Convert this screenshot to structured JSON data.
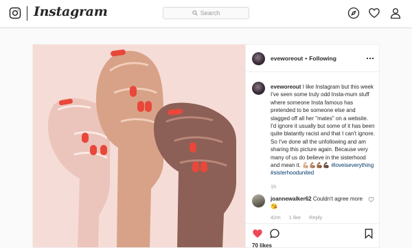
{
  "topnav": {
    "brand": "Instagram",
    "search_placeholder": "Search",
    "icons": [
      "instagram-glyph-icon",
      "search-icon",
      "compass-icon",
      "heart-icon",
      "person-icon"
    ]
  },
  "post": {
    "owner": {
      "username": "eveworeout",
      "follow_state": "Following"
    },
    "caption": {
      "username": "eveworeout",
      "text": "I like Instagram but this week I've seen some truly odd Insta-mum stuff where someone Insta famous has pretended to be someone else and slagged off all her \"mates\" on a website. I'd ignore it usually but some of it has been quite blatantly racist and that I can't ignore. So I've done all the unfollowing and am sharing this picture again. Because very many of us do believe in the sisterhood and mean it.",
      "emoji": "💪🏼💪🏽💪🏾💪🏿",
      "hashtags": [
        "#loveiseverything",
        "#sisterhoodunited"
      ],
      "time": "1h"
    },
    "comment": {
      "username": "joannewalker62",
      "text": "Couldn't agree more",
      "emoji": "😘",
      "time": "42m",
      "likes": "1 like",
      "reply_label": "Reply"
    },
    "likes_text": "70 likes",
    "colors": {
      "background": "#f6dcd7",
      "skin_light": "#ebc4bb",
      "skin_medium": "#d7a287",
      "skin_dark": "#8c6056",
      "nails": "#e8473a",
      "like_red": "#ed4956",
      "link_blue": "#003569"
    }
  }
}
